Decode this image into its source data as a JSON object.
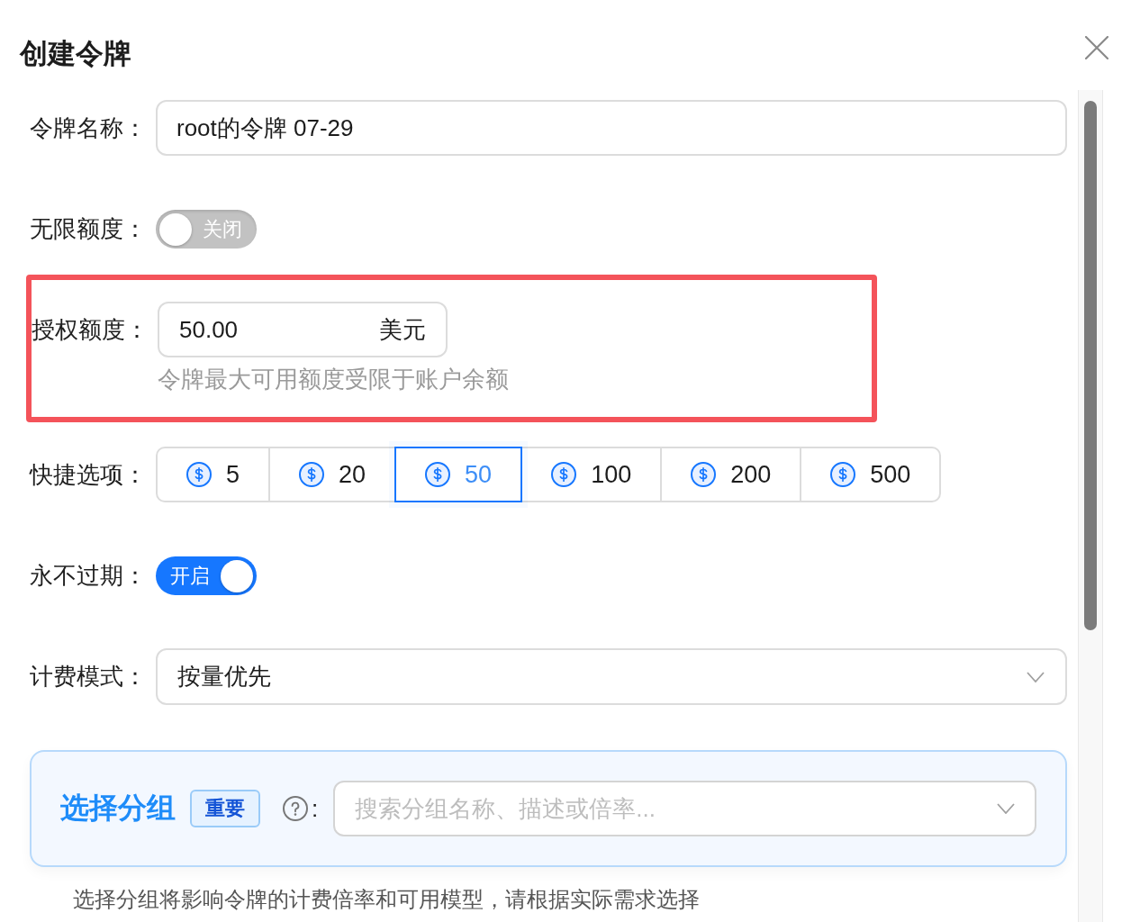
{
  "dialog": {
    "title": "创建令牌"
  },
  "fields": [
    {
      "kind": "text",
      "label": "令牌名称：",
      "value": "root的令牌 07-29",
      "highlighted": false
    },
    {
      "kind": "switch",
      "label": "无限额度：",
      "on": false,
      "state_text": "关闭",
      "highlighted": false
    },
    {
      "kind": "amount",
      "label": "授权额度：",
      "value": "50.00",
      "unit": "美元",
      "help": "令牌最大可用额度受限于账户余额",
      "highlighted": true
    },
    {
      "kind": "presets",
      "label": "快捷选项：",
      "highlighted": false,
      "options": [
        {
          "amount": "5",
          "selected": false
        },
        {
          "amount": "20",
          "selected": false
        },
        {
          "amount": "50",
          "selected": true
        },
        {
          "amount": "100",
          "selected": false
        },
        {
          "amount": "200",
          "selected": false
        },
        {
          "amount": "500",
          "selected": false
        }
      ]
    },
    {
      "kind": "switch",
      "label": "永不过期：",
      "on": true,
      "state_text": "开启",
      "highlighted": false
    },
    {
      "kind": "select",
      "label": "计费模式：",
      "value": "按量优先",
      "highlighted": false
    }
  ],
  "group_panel": {
    "title": "选择分组",
    "tag": "重要",
    "colon": ":",
    "placeholder": "搜索分组名称、描述或倍率...",
    "note": "选择分组将影响令牌的计费倍率和可用模型，请根据实际需求选择"
  }
}
